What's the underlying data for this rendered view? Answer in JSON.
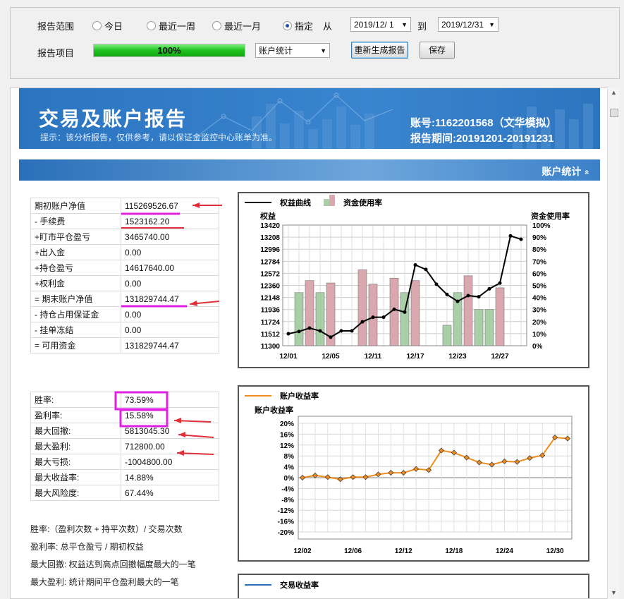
{
  "toolbar": {
    "range_label": "报告范围",
    "radios": [
      "今日",
      "最近一周",
      "最近一月",
      "指定"
    ],
    "from_label": "从",
    "from_date": "2019/12/ 1",
    "to_label": "到",
    "to_date": "2019/12/31",
    "item_label": "报告项目",
    "progress_text": "100%",
    "progress": 1.0,
    "report_select": "账户统计",
    "regen_button": "重新生成报告",
    "save_button": "保存"
  },
  "banner": {
    "title": "交易及账户报告",
    "notice": "提示：该分析报告，仅供参考，请以保证金监控中心账单为准。",
    "account": "账号:1162201568（文华模拟）",
    "period": "报告期间:20191201-20191231"
  },
  "section": {
    "title": "账户统计",
    "chevron": "»"
  },
  "account_table": [
    [
      "期初账户净值",
      "115269526.67"
    ],
    [
      "- 手续费",
      "1523162.20"
    ],
    [
      "+盯市平仓盈亏",
      "3465740.00"
    ],
    [
      "+出入金",
      "0.00"
    ],
    [
      "+持仓盈亏",
      "14617640.00"
    ],
    [
      "+权利金",
      "0.00"
    ],
    [
      "= 期末账户净值",
      "131829744.47"
    ],
    [
      "- 持仓占用保证金",
      "0.00"
    ],
    [
      "- 挂单冻结",
      "0.00"
    ],
    [
      "= 可用资金",
      "131829744.47"
    ]
  ],
  "stats_table": [
    [
      "胜率:",
      "73.59%"
    ],
    [
      "盈利率:",
      "15.58%"
    ],
    [
      "最大回撤:",
      "5813045.30"
    ],
    [
      "最大盈利:",
      "712800.00"
    ],
    [
      "最大亏损:",
      "-1004800.00"
    ],
    [
      "最大收益率:",
      "14.88%"
    ],
    [
      "最大风险度:",
      "67.44%"
    ]
  ],
  "notes": [
    "胜率:（盈利次数 + 持平次数）/ 交易次数",
    "盈利率: 总平仓盈亏 / 期初权益",
    "最大回撤: 权益达到高点回撤幅度最大的一笔",
    "最大盈利: 统计期间平仓盈利最大的一笔"
  ],
  "third_chart_legend": "交易收益率",
  "colors": {
    "accent_blue": "#3a85cf",
    "annotation_red": "#e0303a",
    "annotation_magenta": "#e020e0",
    "equity_line": "#000000",
    "usage_green": "#a9cfa9",
    "usage_pink": "#d9a7ae",
    "return_line": "#f08c1e"
  },
  "chart_data": [
    {
      "type": "bar+line",
      "legend": [
        "权益曲线",
        "资金使用率"
      ],
      "ylabel_left": "权益",
      "ylabel_right": "资金使用率",
      "yticks_left": [
        "13420",
        "13208",
        "12996",
        "12784",
        "12572",
        "12360",
        "12148",
        "11936",
        "11724",
        "11512",
        "11300"
      ],
      "yticks_right": [
        "100%",
        "90%",
        "80%",
        "70%",
        "60%",
        "50%",
        "40%",
        "30%",
        "20%",
        "10%",
        "0%"
      ],
      "xticks": [
        "12/01",
        "12/05",
        "12/11",
        "12/17",
        "12/23",
        "12/27"
      ],
      "ylim_left": [
        11300,
        13420
      ],
      "ylim_right": [
        0,
        100
      ],
      "equity": [
        11510,
        11550,
        11610,
        11560,
        11450,
        11560,
        11560,
        11720,
        11800,
        11800,
        11940,
        11890,
        12720,
        12640,
        12380,
        12200,
        12080,
        12180,
        12160,
        12300,
        12400,
        13230,
        13170
      ],
      "usage_bars": [
        {
          "pos": 0,
          "value": 44,
          "color": "green"
        },
        {
          "pos": 1,
          "value": 54,
          "color": "pink"
        },
        {
          "pos": 2,
          "value": 44,
          "color": "green"
        },
        {
          "pos": 3,
          "value": 52,
          "color": "pink"
        },
        {
          "pos": 6,
          "value": 63,
          "color": "pink"
        },
        {
          "pos": 7,
          "value": 51,
          "color": "pink"
        },
        {
          "pos": 9,
          "value": 56,
          "color": "pink"
        },
        {
          "pos": 10,
          "value": 44,
          "color": "green"
        },
        {
          "pos": 11,
          "value": 54,
          "color": "pink"
        },
        {
          "pos": 14,
          "value": 17,
          "color": "green"
        },
        {
          "pos": 15,
          "value": 44,
          "color": "green"
        },
        {
          "pos": 16,
          "value": 58,
          "color": "pink"
        },
        {
          "pos": 17,
          "value": 30,
          "color": "green"
        },
        {
          "pos": 18,
          "value": 30,
          "color": "green"
        },
        {
          "pos": 19,
          "value": 48,
          "color": "pink"
        }
      ]
    },
    {
      "type": "line",
      "legend": [
        "账户收益率"
      ],
      "ylabel": "账户收益率",
      "yticks": [
        "20%",
        "16%",
        "12%",
        "8%",
        "4%",
        "0%",
        "-4%",
        "-8%",
        "-12%",
        "-16%",
        "-20%"
      ],
      "xticks": [
        "12/02",
        "12/06",
        "12/12",
        "12/18",
        "12/24",
        "12/30"
      ],
      "ylim": [
        -22,
        22
      ],
      "values": [
        0.0,
        0.8,
        0.2,
        -0.6,
        0.2,
        0.2,
        1.2,
        1.8,
        1.8,
        3.2,
        2.8,
        10.0,
        9.2,
        7.4,
        5.6,
        4.8,
        6.0,
        5.8,
        7.2,
        8.2,
        14.8,
        14.4
      ]
    }
  ]
}
